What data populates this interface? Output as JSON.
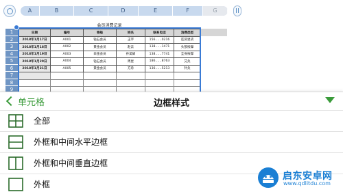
{
  "columns": [
    "A",
    "B",
    "C",
    "D",
    "E",
    "F",
    "G"
  ],
  "rows": [
    "1",
    "2",
    "3",
    "4",
    "5",
    "6",
    "7",
    "8",
    "9"
  ],
  "sheet": {
    "title": "会员消费记录",
    "headers": [
      "日期",
      "编号",
      "等级",
      "姓名",
      "联系电话",
      "消费类型"
    ],
    "records": [
      [
        "2018年1月17日",
        "A001",
        "钻石会员",
        "王宇",
        "156……0216",
        "还货退货"
      ],
      [
        "2018年1月18日",
        "A002",
        "黄金会员",
        "赵云",
        "138……1471",
        "头部按摩"
      ],
      [
        "2018年1月19日",
        "A003",
        "白金会员",
        "孙美娟",
        "138……7741",
        "全身按摩"
      ],
      [
        "2018年1月20日",
        "A004",
        "钻石会员",
        "周星",
        "186……8763",
        "艾灸"
      ],
      [
        "2018年1月21日",
        "A005",
        "黄金会员",
        "方舟",
        "136……5213",
        "针灸"
      ]
    ]
  },
  "panel": {
    "back_label": "单元格",
    "title": "边框样式",
    "options": [
      {
        "label": "全部",
        "icon": "border-all-icon"
      },
      {
        "label": "外框和中间水平边框",
        "icon": "border-outer-horizontal-icon"
      },
      {
        "label": "外框和中间垂直边框",
        "icon": "border-outer-vertical-icon"
      },
      {
        "label": "外框",
        "icon": "border-outer-icon"
      }
    ]
  },
  "watermark": {
    "name": "启东安卓网",
    "url": "www.qdlitdu.com"
  },
  "colors": {
    "accent_green": "#3a9b3a",
    "selection_blue": "#3a7bd5",
    "header_blue": "#c8d9ee"
  }
}
